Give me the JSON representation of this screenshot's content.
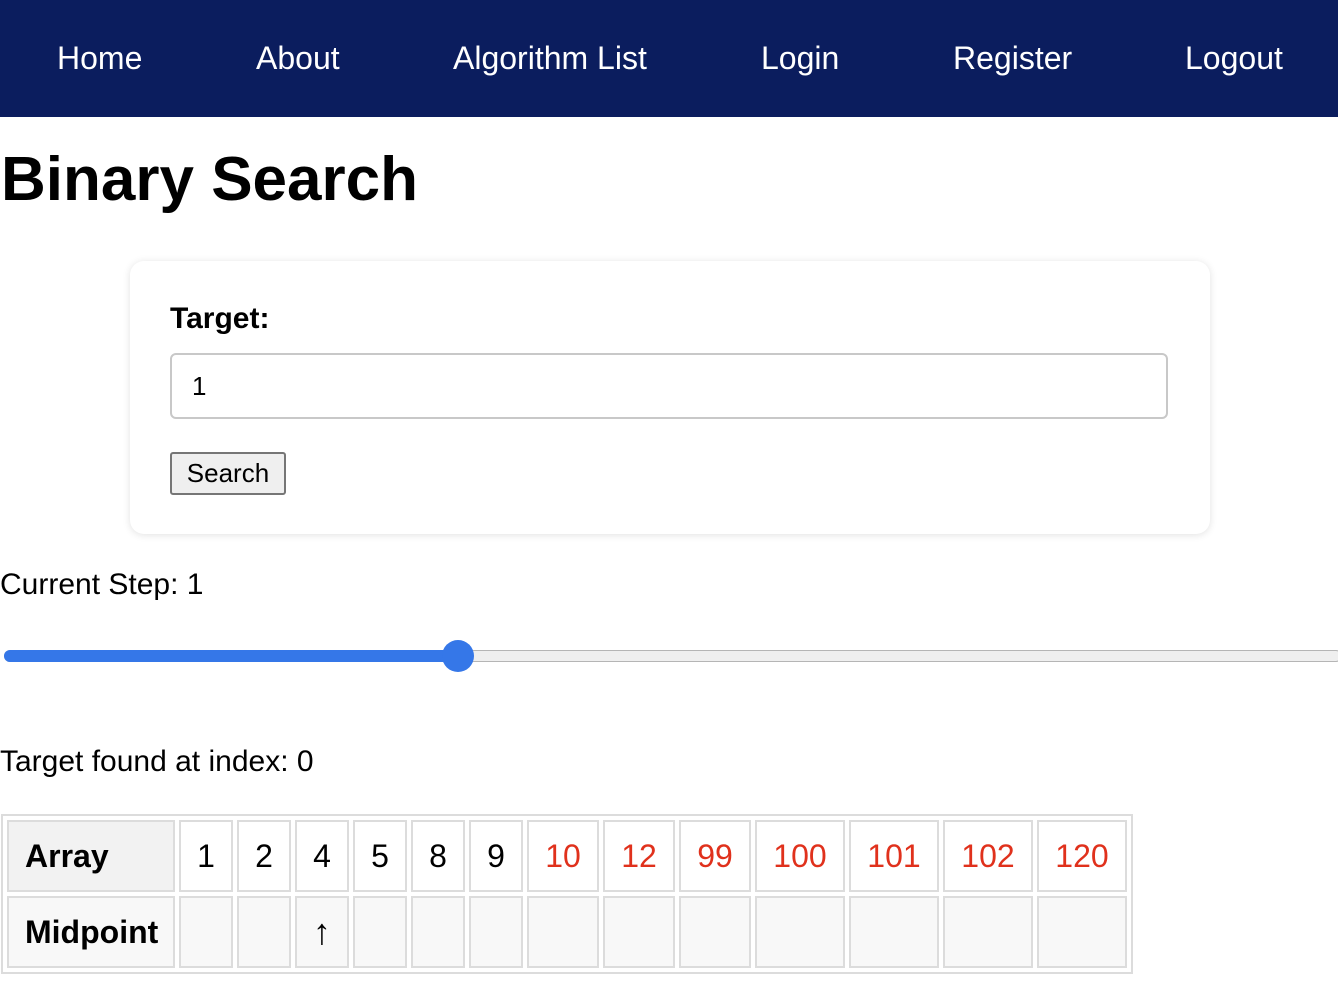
{
  "nav": {
    "items": [
      "Home",
      "About",
      "Algorithm List",
      "Login",
      "Register",
      "Logout"
    ]
  },
  "page": {
    "title": "Binary Search"
  },
  "form": {
    "target_label": "Target:",
    "target_value": "1",
    "search_label": "Search"
  },
  "step": {
    "text": "Current Step: 1",
    "slider_fraction": 0.34
  },
  "result": {
    "text": "Target found at index: 0"
  },
  "table": {
    "array_label": "Array",
    "midpoint_label": "Midpoint",
    "values": [
      "1",
      "2",
      "4",
      "5",
      "8",
      "9",
      "10",
      "12",
      "99",
      "100",
      "101",
      "102",
      "120"
    ],
    "excluded_from": 6,
    "midpoint_index": 2,
    "midpoint_marker": "↑"
  },
  "colors": {
    "nav_bg": "#0b1d5e",
    "accent": "#3577e8",
    "excluded_text": "#e0311c"
  }
}
